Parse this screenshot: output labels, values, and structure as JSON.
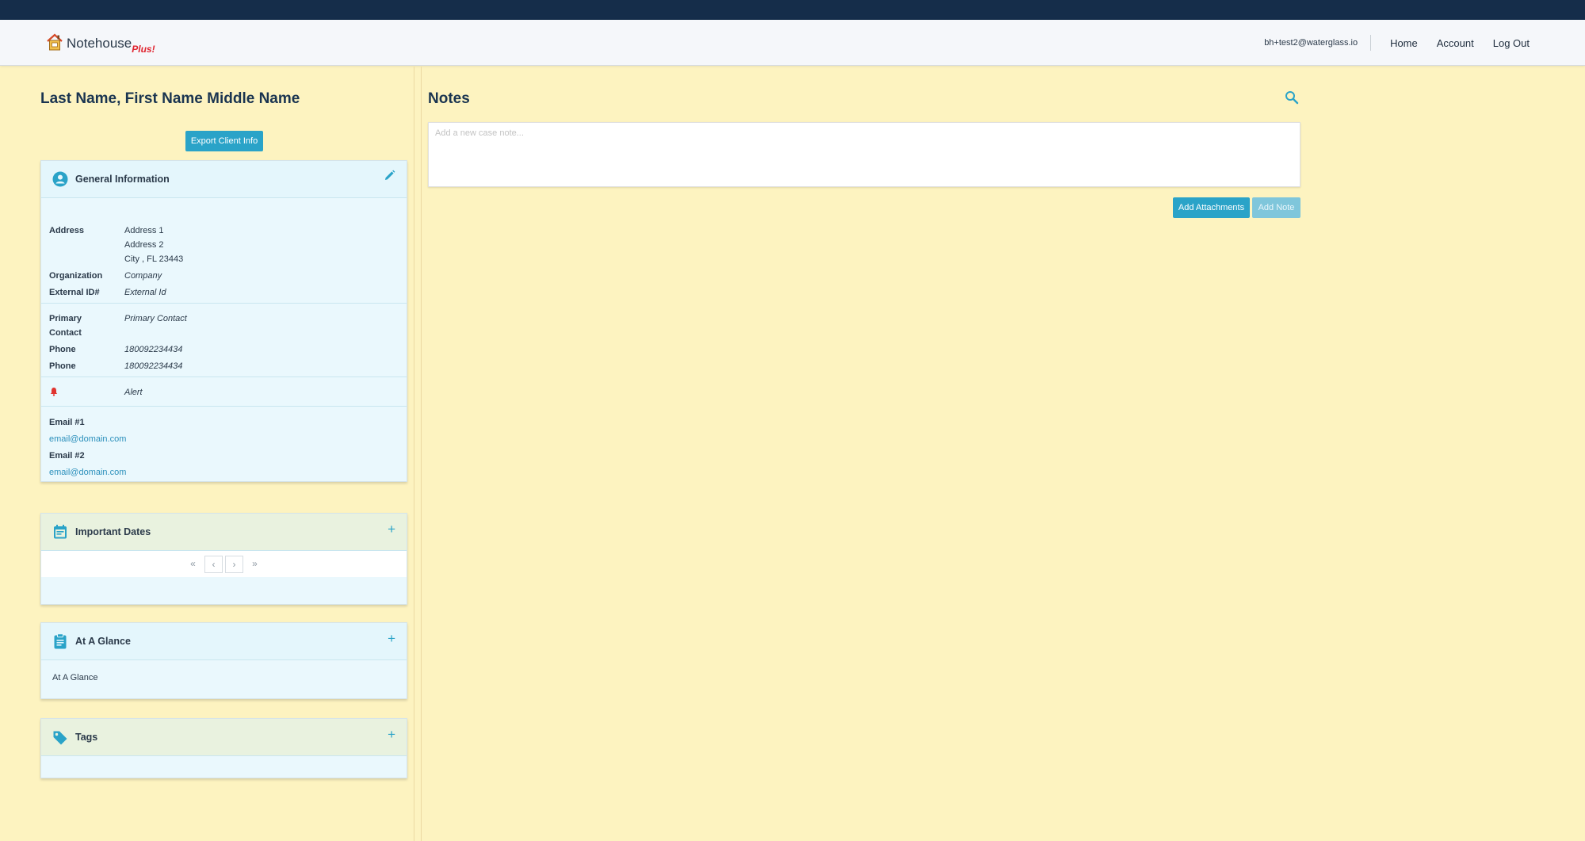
{
  "nav": {
    "brand_name": "Notehouse",
    "brand_suffix": "Plus!",
    "user_email": "bh+test2@waterglass.io",
    "links": [
      "Home",
      "Account",
      "Log Out"
    ]
  },
  "client": {
    "name": "Last Name, First Name Middle Name",
    "export_label": "Export Client Info"
  },
  "general": {
    "title": "General Information",
    "address_label": "Address",
    "address_lines": [
      "Address 1",
      "Address 2",
      "City , FL 23443"
    ],
    "organization_label": "Organization",
    "organization": "Company",
    "external_id_label": "External ID#",
    "external_id": "External Id",
    "primary_contact_label_1": "Primary",
    "primary_contact_label_2": "Contact",
    "primary_contact": "Primary Contact",
    "phones": [
      {
        "label": "Phone",
        "value": "180092234434"
      },
      {
        "label": "Phone",
        "value": "180092234434"
      }
    ],
    "alert": "Alert",
    "emails": [
      {
        "label": "Email #1",
        "value": "email@domain.com"
      },
      {
        "label": "Email #2",
        "value": "email@domain.com"
      }
    ]
  },
  "important_dates": {
    "title": "Important Dates",
    "pager": [
      "«",
      "‹",
      "›",
      "»"
    ]
  },
  "at_a_glance": {
    "title": "At A Glance",
    "content": "At A Glance"
  },
  "tags": {
    "title": "Tags"
  },
  "notes": {
    "title": "Notes",
    "placeholder": "Add a new case note...",
    "add_attachments_label": "Add Attachments",
    "add_note_label": "Add Note"
  },
  "icons": {
    "logo": "house-logo-icon",
    "general": "person-circle-icon",
    "edit": "pencil-icon",
    "alert": "bell-icon",
    "dates": "calendar-icon",
    "glance": "clipboard-icon",
    "tags": "tag-icon",
    "add": "plus-icon",
    "search": "search-icon"
  },
  "colors": {
    "topbar": "#152d4a",
    "background": "#fdf3c0",
    "accent": "#2aa3c8",
    "alert": "#e0342f",
    "card": "#eaf8fd"
  }
}
